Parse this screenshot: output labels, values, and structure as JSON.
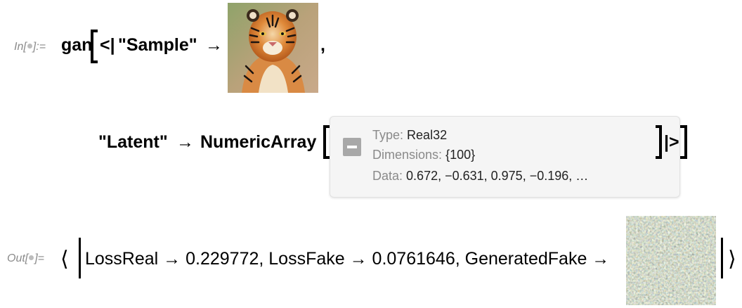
{
  "input": {
    "label": "In[",
    "label_end": "]:=",
    "function_name": "gan",
    "open_assoc": "<|",
    "sample_key": "\"Sample\"",
    "arrow": "→",
    "comma": ",",
    "latent_key": "\"Latent\"",
    "numeric_array": "NumericArray",
    "close_assoc": "|>",
    "summary": {
      "type_label": "Type:",
      "type_value": "Real32",
      "dimensions_label": "Dimensions:",
      "dimensions_value": "{100}",
      "data_label": "Data:",
      "data_value": "0.672, −0.631, 0.975, −0.196, …"
    }
  },
  "output": {
    "label": "Out[",
    "label_end": "]=",
    "open_angle": "⟨",
    "close_angle": "⟩",
    "text": "LossReal → 0.229772, LossFake → 0.0761646, GeneratedFake →"
  },
  "colors": {
    "label_gray": "#8a8a8a",
    "summary_bg": "#f5f5f5",
    "minus_button": "#a8a8a8"
  },
  "icons": [
    "collapse-minus-icon",
    "tiger-image",
    "generated-noise-image"
  ]
}
